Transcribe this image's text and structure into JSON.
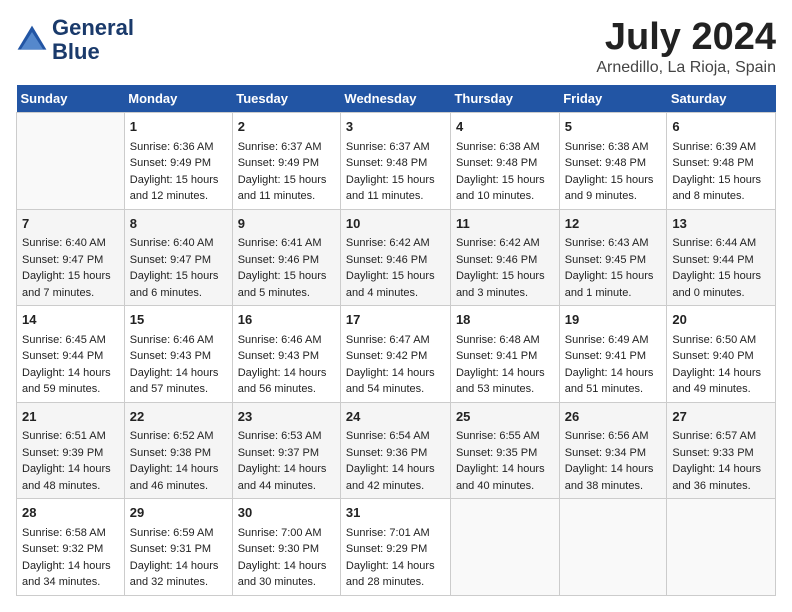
{
  "header": {
    "logo_line1": "General",
    "logo_line2": "Blue",
    "title": "July 2024",
    "subtitle": "Arnedillo, La Rioja, Spain"
  },
  "weekdays": [
    "Sunday",
    "Monday",
    "Tuesday",
    "Wednesday",
    "Thursday",
    "Friday",
    "Saturday"
  ],
  "weeks": [
    [
      {
        "day": "",
        "content": ""
      },
      {
        "day": "1",
        "content": "Sunrise: 6:36 AM\nSunset: 9:49 PM\nDaylight: 15 hours\nand 12 minutes."
      },
      {
        "day": "2",
        "content": "Sunrise: 6:37 AM\nSunset: 9:49 PM\nDaylight: 15 hours\nand 11 minutes."
      },
      {
        "day": "3",
        "content": "Sunrise: 6:37 AM\nSunset: 9:48 PM\nDaylight: 15 hours\nand 11 minutes."
      },
      {
        "day": "4",
        "content": "Sunrise: 6:38 AM\nSunset: 9:48 PM\nDaylight: 15 hours\nand 10 minutes."
      },
      {
        "day": "5",
        "content": "Sunrise: 6:38 AM\nSunset: 9:48 PM\nDaylight: 15 hours\nand 9 minutes."
      },
      {
        "day": "6",
        "content": "Sunrise: 6:39 AM\nSunset: 9:48 PM\nDaylight: 15 hours\nand 8 minutes."
      }
    ],
    [
      {
        "day": "7",
        "content": "Sunrise: 6:40 AM\nSunset: 9:47 PM\nDaylight: 15 hours\nand 7 minutes."
      },
      {
        "day": "8",
        "content": "Sunrise: 6:40 AM\nSunset: 9:47 PM\nDaylight: 15 hours\nand 6 minutes."
      },
      {
        "day": "9",
        "content": "Sunrise: 6:41 AM\nSunset: 9:46 PM\nDaylight: 15 hours\nand 5 minutes."
      },
      {
        "day": "10",
        "content": "Sunrise: 6:42 AM\nSunset: 9:46 PM\nDaylight: 15 hours\nand 4 minutes."
      },
      {
        "day": "11",
        "content": "Sunrise: 6:42 AM\nSunset: 9:46 PM\nDaylight: 15 hours\nand 3 minutes."
      },
      {
        "day": "12",
        "content": "Sunrise: 6:43 AM\nSunset: 9:45 PM\nDaylight: 15 hours\nand 1 minute."
      },
      {
        "day": "13",
        "content": "Sunrise: 6:44 AM\nSunset: 9:44 PM\nDaylight: 15 hours\nand 0 minutes."
      }
    ],
    [
      {
        "day": "14",
        "content": "Sunrise: 6:45 AM\nSunset: 9:44 PM\nDaylight: 14 hours\nand 59 minutes."
      },
      {
        "day": "15",
        "content": "Sunrise: 6:46 AM\nSunset: 9:43 PM\nDaylight: 14 hours\nand 57 minutes."
      },
      {
        "day": "16",
        "content": "Sunrise: 6:46 AM\nSunset: 9:43 PM\nDaylight: 14 hours\nand 56 minutes."
      },
      {
        "day": "17",
        "content": "Sunrise: 6:47 AM\nSunset: 9:42 PM\nDaylight: 14 hours\nand 54 minutes."
      },
      {
        "day": "18",
        "content": "Sunrise: 6:48 AM\nSunset: 9:41 PM\nDaylight: 14 hours\nand 53 minutes."
      },
      {
        "day": "19",
        "content": "Sunrise: 6:49 AM\nSunset: 9:41 PM\nDaylight: 14 hours\nand 51 minutes."
      },
      {
        "day": "20",
        "content": "Sunrise: 6:50 AM\nSunset: 9:40 PM\nDaylight: 14 hours\nand 49 minutes."
      }
    ],
    [
      {
        "day": "21",
        "content": "Sunrise: 6:51 AM\nSunset: 9:39 PM\nDaylight: 14 hours\nand 48 minutes."
      },
      {
        "day": "22",
        "content": "Sunrise: 6:52 AM\nSunset: 9:38 PM\nDaylight: 14 hours\nand 46 minutes."
      },
      {
        "day": "23",
        "content": "Sunrise: 6:53 AM\nSunset: 9:37 PM\nDaylight: 14 hours\nand 44 minutes."
      },
      {
        "day": "24",
        "content": "Sunrise: 6:54 AM\nSunset: 9:36 PM\nDaylight: 14 hours\nand 42 minutes."
      },
      {
        "day": "25",
        "content": "Sunrise: 6:55 AM\nSunset: 9:35 PM\nDaylight: 14 hours\nand 40 minutes."
      },
      {
        "day": "26",
        "content": "Sunrise: 6:56 AM\nSunset: 9:34 PM\nDaylight: 14 hours\nand 38 minutes."
      },
      {
        "day": "27",
        "content": "Sunrise: 6:57 AM\nSunset: 9:33 PM\nDaylight: 14 hours\nand 36 minutes."
      }
    ],
    [
      {
        "day": "28",
        "content": "Sunrise: 6:58 AM\nSunset: 9:32 PM\nDaylight: 14 hours\nand 34 minutes."
      },
      {
        "day": "29",
        "content": "Sunrise: 6:59 AM\nSunset: 9:31 PM\nDaylight: 14 hours\nand 32 minutes."
      },
      {
        "day": "30",
        "content": "Sunrise: 7:00 AM\nSunset: 9:30 PM\nDaylight: 14 hours\nand 30 minutes."
      },
      {
        "day": "31",
        "content": "Sunrise: 7:01 AM\nSunset: 9:29 PM\nDaylight: 14 hours\nand 28 minutes."
      },
      {
        "day": "",
        "content": ""
      },
      {
        "day": "",
        "content": ""
      },
      {
        "day": "",
        "content": ""
      }
    ]
  ]
}
